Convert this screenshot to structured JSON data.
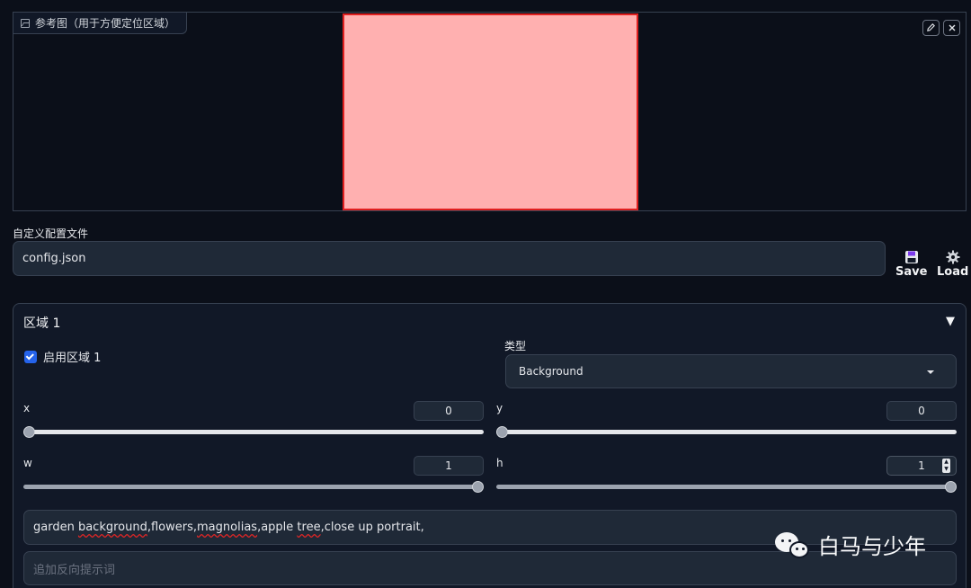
{
  "reference_panel": {
    "label": "参考图（用于方便定位区域）",
    "canvas_fill": "#ffb0b0",
    "canvas_border": "#e02020",
    "edit_icon": "pencil-icon",
    "clear_icon": "close-icon"
  },
  "config": {
    "label": "自定义配置文件",
    "value": "config.json",
    "save_label": "Save",
    "load_label": "Load",
    "save_icon": "floppy-disk-icon",
    "load_icon": "gear-icon"
  },
  "region": {
    "title": "区域 1",
    "collapse_glyph": "▼",
    "enable_label": "启用区域 1",
    "enabled": true,
    "type_label": "类型",
    "type_value": "Background",
    "sliders": {
      "x": {
        "label": "x",
        "value": "0",
        "fraction": 0
      },
      "y": {
        "label": "y",
        "value": "0",
        "fraction": 0
      },
      "w": {
        "label": "w",
        "value": "1",
        "fraction": 1
      },
      "h": {
        "label": "h",
        "value": "1",
        "fraction": 1
      }
    },
    "prompt": {
      "pre": "garden ",
      "u1": "background",
      "mid1": ",flowers,",
      "u2": "magnolias",
      "mid2": ",apple ",
      "u3": "tree",
      "mid3": ",close up portrait,"
    },
    "negative_placeholder": "追加反向提示词"
  },
  "watermark": {
    "text": "白马与少年",
    "icon": "wechat-icon"
  },
  "colors": {
    "background": "#0b0f19",
    "panel": "#111827",
    "input": "#1f2937",
    "border": "#374151",
    "accent": "#2563eb"
  }
}
